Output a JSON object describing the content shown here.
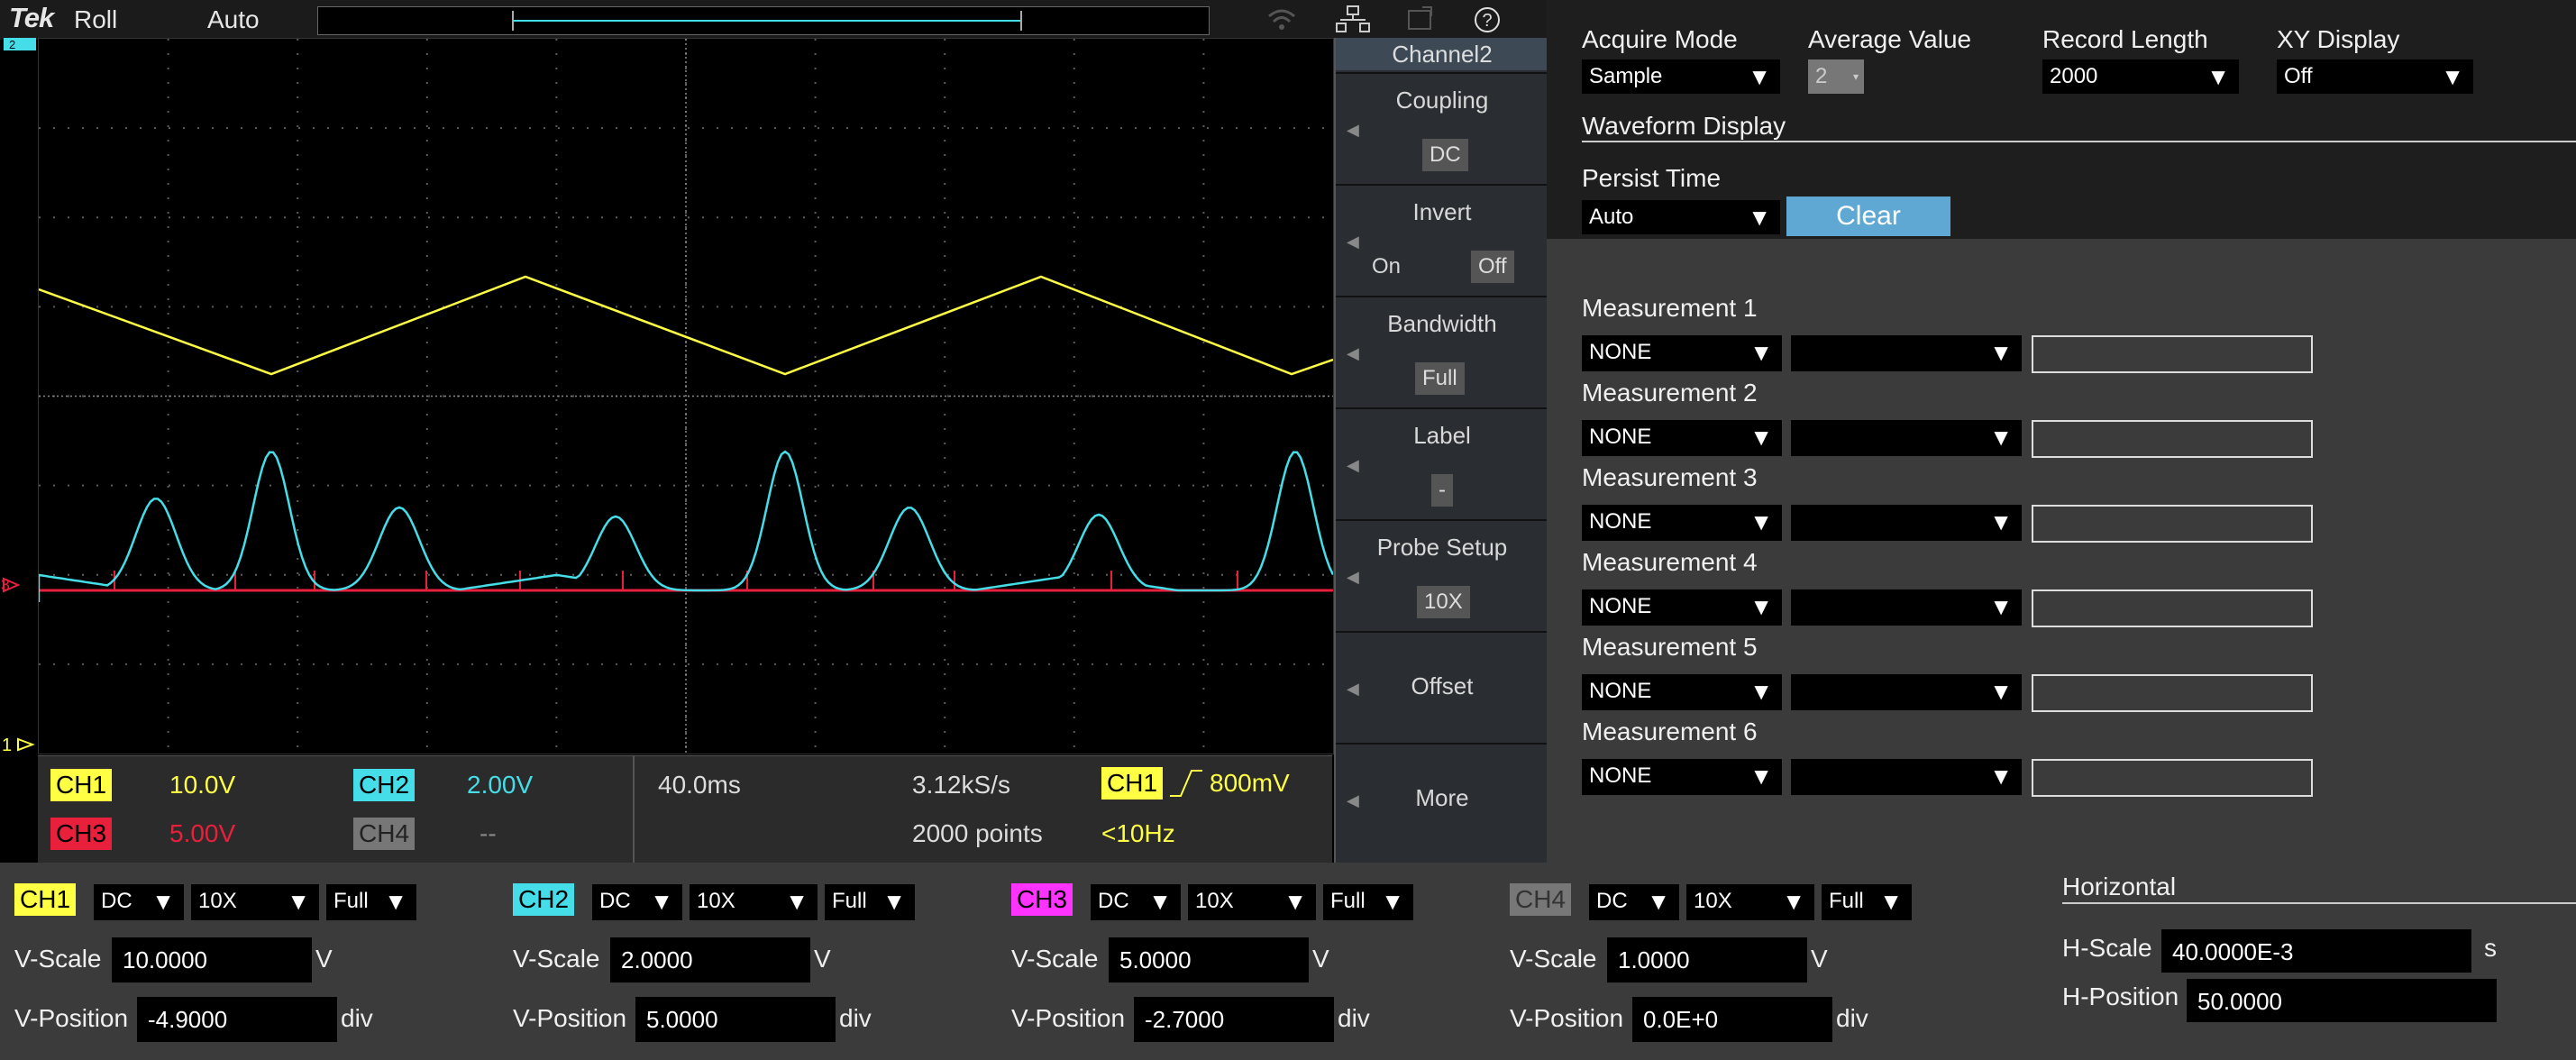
{
  "topbar": {
    "brand": "Tek",
    "mode": "Roll",
    "trigger_mode": "Auto"
  },
  "sidemenu": {
    "title": "Channel2",
    "items": [
      {
        "label": "Coupling",
        "value": "DC"
      },
      {
        "label": "Invert",
        "on": "On",
        "off": "Off"
      },
      {
        "label": "Bandwidth",
        "value": "Full"
      },
      {
        "label": "Label",
        "value": "-"
      },
      {
        "label": "Probe Setup",
        "value": "10X"
      },
      {
        "label": "Offset"
      },
      {
        "label": "More"
      }
    ]
  },
  "status": {
    "ch1": {
      "name": "CH1",
      "scale": "10.0V",
      "color": "#ffff44"
    },
    "ch2": {
      "name": "CH2",
      "scale": "2.00V",
      "color": "#44dde8"
    },
    "ch3": {
      "name": "CH3",
      "scale": "5.00V",
      "color": "#e8203c"
    },
    "ch4": {
      "name": "CH4",
      "scale": "--",
      "color": "#777777"
    },
    "timebase": "40.0ms",
    "sample_rate": "3.12kS/s",
    "points": "2000 points",
    "trigger_ch": "CH1",
    "trigger_level": "800mV",
    "trigger_freq": "<10Hz"
  },
  "settings": {
    "acquire_mode": {
      "label": "Acquire Mode",
      "value": "Sample"
    },
    "average_value": {
      "label": "Average Value",
      "value": "2"
    },
    "record_length": {
      "label": "Record Length",
      "value": "2000"
    },
    "xy_display": {
      "label": "XY Display",
      "value": "Off"
    },
    "waveform_display": "Waveform Display",
    "persist_time": {
      "label": "Persist Time",
      "value": "Auto"
    },
    "clear_label": "Clear"
  },
  "measurements": [
    {
      "label": "Measurement 1",
      "type": "NONE",
      "source": "",
      "value": ""
    },
    {
      "label": "Measurement 2",
      "type": "NONE",
      "source": "",
      "value": ""
    },
    {
      "label": "Measurement 3",
      "type": "NONE",
      "source": "",
      "value": ""
    },
    {
      "label": "Measurement 4",
      "type": "NONE",
      "source": "",
      "value": ""
    },
    {
      "label": "Measurement 5",
      "type": "NONE",
      "source": "",
      "value": ""
    },
    {
      "label": "Measurement 6",
      "type": "NONE",
      "source": "",
      "value": ""
    }
  ],
  "channels": [
    {
      "name": "CH1",
      "coupling": "DC",
      "probe": "10X",
      "bandwidth": "Full",
      "vscale": "10.0000",
      "vpos": "-4.9000",
      "color": "#ffff44"
    },
    {
      "name": "CH2",
      "coupling": "DC",
      "probe": "10X",
      "bandwidth": "Full",
      "vscale": "2.0000",
      "vpos": "5.0000",
      "color": "#44dde8"
    },
    {
      "name": "CH3",
      "coupling": "DC",
      "probe": "10X",
      "bandwidth": "Full",
      "vscale": "5.0000",
      "vpos": "-2.7000",
      "color": "#ff33ff"
    },
    {
      "name": "CH4",
      "coupling": "DC",
      "probe": "10X",
      "bandwidth": "Full",
      "vscale": "1.0000",
      "vpos": "0.0E+0",
      "color": "#888888"
    }
  ],
  "labels": {
    "vscale": "V-Scale",
    "vpos": "V-Position",
    "unit_v": "V",
    "unit_div": "div",
    "unit_s": "s"
  },
  "horizontal": {
    "title": "Horizontal",
    "hscale_label": "H-Scale",
    "hscale": "40.0000E-3",
    "hpos_label": "H-Position",
    "hpos": "50.0000"
  }
}
